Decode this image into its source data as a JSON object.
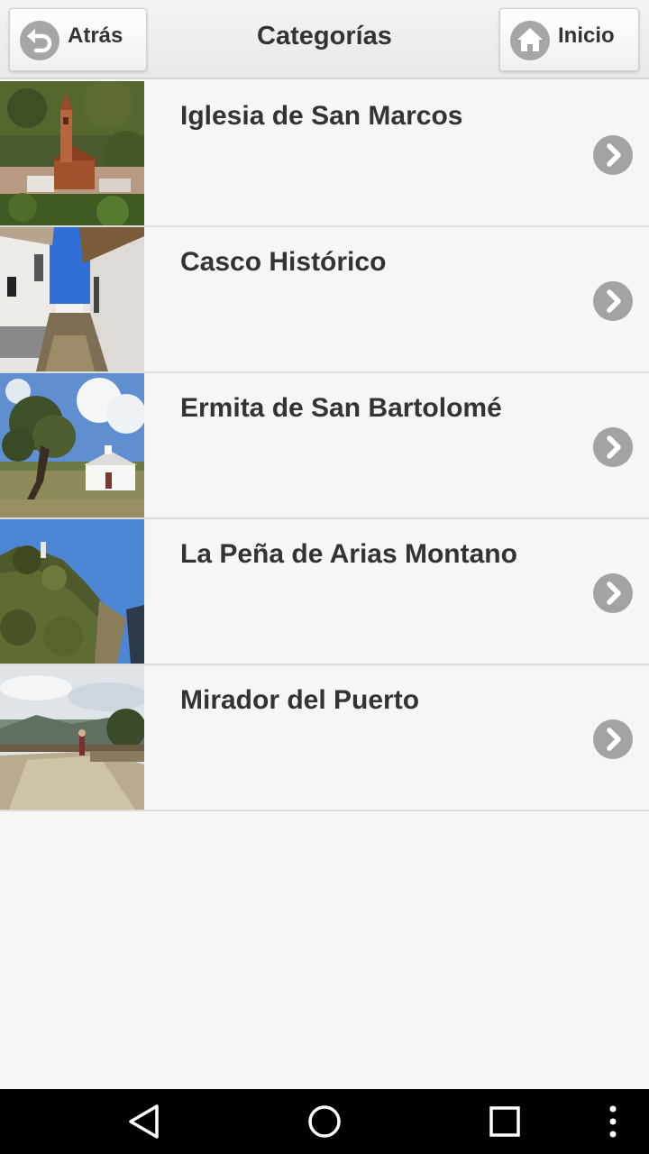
{
  "header": {
    "title": "Categorías",
    "back_label": "Atrás",
    "home_label": "Inicio"
  },
  "items": [
    {
      "label": "Iglesia de San Marcos",
      "thumb": "church-tower-village-photo"
    },
    {
      "label": "Casco Histórico",
      "thumb": "whitewashed-street-photo"
    },
    {
      "label": "Ermita de San Bartolomé",
      "thumb": "hermitage-olive-tree-photo"
    },
    {
      "label": "La Peña de Arias Montano",
      "thumb": "rocky-cliff-photo"
    },
    {
      "label": "Mirador del Puerto",
      "thumb": "viewpoint-terrace-photo"
    }
  ],
  "colors": {
    "header_bg": "#ececec",
    "icon_bg": "#a6a6a6",
    "row_bg": "#f6f6f6",
    "text": "#333333",
    "navbar_bg": "#000000"
  },
  "icons": {
    "back": "undo-arrow-icon",
    "home": "house-icon",
    "row": "chevron-right-icon"
  }
}
